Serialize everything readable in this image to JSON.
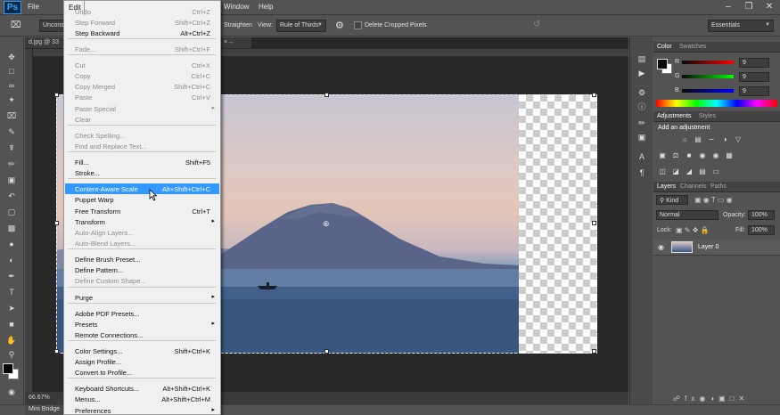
{
  "app": {
    "logo": "Ps"
  },
  "menubar": {
    "items": [
      "File",
      "Edit",
      "Window",
      "Help"
    ],
    "active": "Edit"
  },
  "options_bar": {
    "ratio_partial": "Unconst",
    "straighten_label": "Straighten",
    "view_label": "View:",
    "view_value": "Rule of Thirds",
    "delete_cropped_label": "Delete Cropped Pixels",
    "workspace": "Essentials"
  },
  "document": {
    "tab_title_partial": "d.jpg @ 33",
    "zoom": "66.67%",
    "mini_bridge": "Mini Bridge"
  },
  "edit_menu": {
    "items": [
      {
        "label": "Undo",
        "shortcut": "Ctrl+Z",
        "disabled": true
      },
      {
        "label": "Step Forward",
        "shortcut": "Shift+Ctrl+Z",
        "disabled": true
      },
      {
        "label": "Step Backward",
        "shortcut": "Alt+Ctrl+Z",
        "disabled": false
      },
      {
        "label": "Fade...",
        "shortcut": "Shift+Ctrl+F",
        "disabled": true
      },
      {
        "label": "Cut",
        "shortcut": "Ctrl+X",
        "disabled": true
      },
      {
        "label": "Copy",
        "shortcut": "Ctrl+C",
        "disabled": true
      },
      {
        "label": "Copy Merged",
        "shortcut": "Shift+Ctrl+C",
        "disabled": true
      },
      {
        "label": "Paste",
        "shortcut": "Ctrl+V",
        "disabled": true
      },
      {
        "label": "Paste Special",
        "shortcut": "",
        "disabled": true,
        "submenu": true
      },
      {
        "label": "Clear",
        "shortcut": "",
        "disabled": true
      },
      {
        "label": "Check Spelling...",
        "shortcut": "",
        "disabled": true
      },
      {
        "label": "Find and Replace Text...",
        "shortcut": "",
        "disabled": true
      },
      {
        "label": "Fill...",
        "shortcut": "Shift+F5",
        "disabled": false
      },
      {
        "label": "Stroke...",
        "shortcut": "",
        "disabled": false
      },
      {
        "label": "Content-Aware Scale",
        "shortcut": "Alt+Shift+Ctrl+C",
        "disabled": false,
        "selected": true
      },
      {
        "label": "Puppet Warp",
        "shortcut": "",
        "disabled": false
      },
      {
        "label": "Free Transform",
        "shortcut": "Ctrl+T",
        "disabled": false
      },
      {
        "label": "Transform",
        "shortcut": "",
        "disabled": false,
        "submenu": true
      },
      {
        "label": "Auto-Align Layers...",
        "shortcut": "",
        "disabled": true
      },
      {
        "label": "Auto-Blend Layers...",
        "shortcut": "",
        "disabled": true
      },
      {
        "label": "Define Brush Preset...",
        "shortcut": "",
        "disabled": false
      },
      {
        "label": "Define Pattern...",
        "shortcut": "",
        "disabled": false
      },
      {
        "label": "Define Custom Shape...",
        "shortcut": "",
        "disabled": true
      },
      {
        "label": "Purge",
        "shortcut": "",
        "disabled": false,
        "submenu": true
      },
      {
        "label": "Adobe PDF Presets...",
        "shortcut": "",
        "disabled": false
      },
      {
        "label": "Presets",
        "shortcut": "",
        "disabled": false,
        "submenu": true
      },
      {
        "label": "Remote Connections...",
        "shortcut": "",
        "disabled": false
      },
      {
        "label": "Color Settings...",
        "shortcut": "Shift+Ctrl+K",
        "disabled": false
      },
      {
        "label": "Assign Profile...",
        "shortcut": "",
        "disabled": false
      },
      {
        "label": "Convert to Profile...",
        "shortcut": "",
        "disabled": false
      },
      {
        "label": "Keyboard Shortcuts...",
        "shortcut": "Alt+Shift+Ctrl+K",
        "disabled": false
      },
      {
        "label": "Menus...",
        "shortcut": "Alt+Shift+Ctrl+M",
        "disabled": false
      },
      {
        "label": "Preferences",
        "shortcut": "",
        "disabled": false,
        "submenu": true
      }
    ]
  },
  "color_panel": {
    "tabs": [
      "Color",
      "Swatches"
    ],
    "channels": [
      {
        "label": "R",
        "value": "9",
        "color": "#ff3b3b"
      },
      {
        "label": "G",
        "value": "9",
        "color": "#3bd13b"
      },
      {
        "label": "B",
        "value": "9",
        "color": "#3b5bff"
      }
    ]
  },
  "adjustments_panel": {
    "tabs": [
      "Adjustments",
      "Styles"
    ],
    "header": "Add an adjustment"
  },
  "layers_panel": {
    "tabs": [
      "Layers",
      "Channels",
      "Paths"
    ],
    "filter": "Kind",
    "blend_mode": "Normal",
    "opacity_label": "Opacity:",
    "opacity": "100%",
    "lock_label": "Lock:",
    "fill_label": "Fill:",
    "fill": "100%",
    "layers": [
      {
        "name": "Layer 0"
      }
    ]
  },
  "colors": {
    "ui_bg": "#535353",
    "selection": "#3399ff",
    "menu_bg": "#f0f0f0"
  }
}
